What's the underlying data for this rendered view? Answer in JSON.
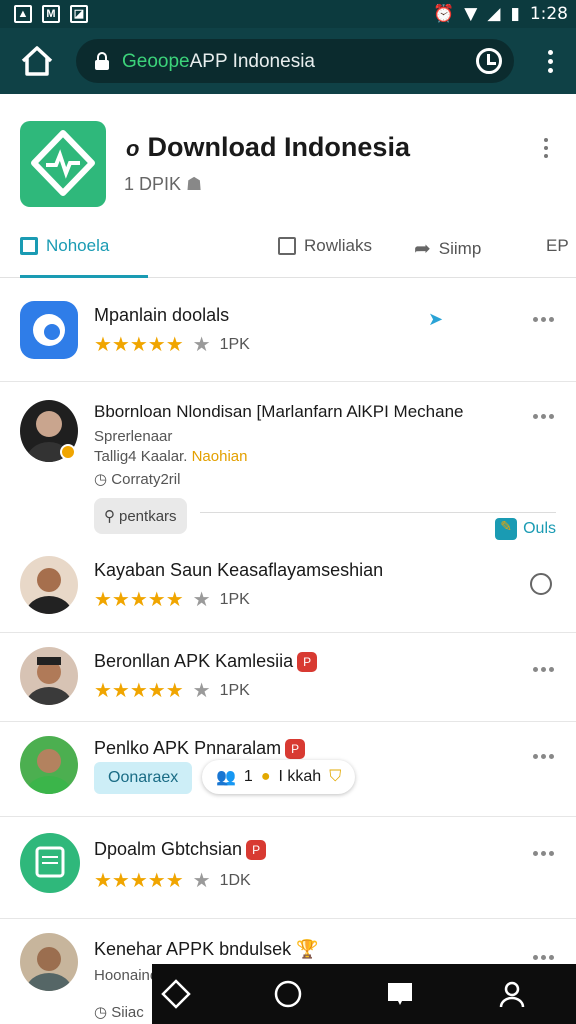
{
  "status": {
    "time": "1:28"
  },
  "browser": {
    "url_green": "Geoope",
    "url_rest": "APP Indonesia"
  },
  "app": {
    "title": "Download Indonesia",
    "title_prefix": "o",
    "subtitle": "1 DPIK"
  },
  "tabs": [
    {
      "label": "Nohoela",
      "icon": "book-icon"
    },
    {
      "label": "Rowliaks",
      "icon": "bag-icon"
    },
    {
      "label": "Siimp",
      "icon": "share-icon"
    },
    {
      "label": "EP",
      "icon": "grid-icon"
    }
  ],
  "items": [
    {
      "title": "Mpanlain doolals",
      "count": "1PK"
    },
    {
      "title": "Bbornloan Nlondisan [Marlanfarn AlKPI Mechane",
      "line1": "Sprerlenaar",
      "line2_prefix": "Tallig4 Kaalar.",
      "line2_accent": "Naohian",
      "line3": "Corraty2ril",
      "chip": "pentkars",
      "action": "Ouls"
    },
    {
      "title": "Kayaban Saun Keasaflayamseshian",
      "count": "1PK"
    },
    {
      "title": "Beronllan APK Kamlesiia",
      "count": "1PK"
    },
    {
      "title": "Penlko APK Pnnaralam",
      "chip_blue": "Oonaraex",
      "chip_pill_a": "1",
      "chip_pill_b": "I kkah"
    },
    {
      "title": "Dpoalm Gbtchsian",
      "count": "1DK"
    },
    {
      "title": "Kenehar APPK bndulsek",
      "line1": "Hoonaino",
      "line2": "Siiac"
    }
  ],
  "colors": {
    "accent": "#1a9bb3",
    "star": "#f0a500",
    "brand_green": "#2fb87b",
    "toolbar": "#0f4146"
  }
}
